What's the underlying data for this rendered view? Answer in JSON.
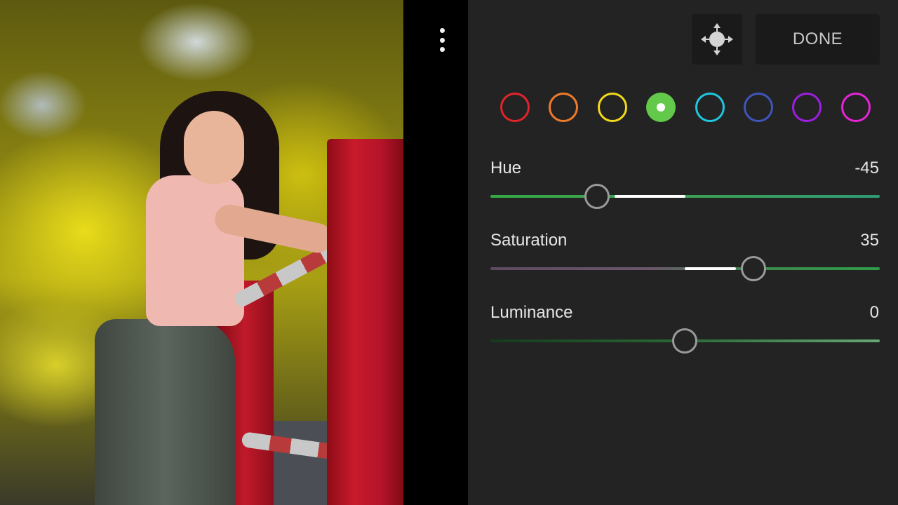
{
  "preview": {
    "description_alt": ""
  },
  "toolbar": {
    "more_icon": "more-vertical-icon",
    "target_icon": "target-adjustment-icon",
    "done_label": "DONE"
  },
  "colors": {
    "swatches": [
      {
        "name": "red",
        "hex": "#e0242b"
      },
      {
        "name": "orange",
        "hex": "#ef7b2a"
      },
      {
        "name": "yellow",
        "hex": "#f2d91c"
      },
      {
        "name": "green",
        "hex": "#63c94a",
        "selected": true
      },
      {
        "name": "aqua",
        "hex": "#1fc6de"
      },
      {
        "name": "blue",
        "hex": "#3f55b9"
      },
      {
        "name": "purple",
        "hex": "#9c1fe0"
      },
      {
        "name": "magenta",
        "hex": "#e624d6"
      }
    ]
  },
  "sliders": {
    "hue": {
      "label": "Hue",
      "value": "-45",
      "min": -100,
      "max": 100
    },
    "saturation": {
      "label": "Saturation",
      "value": "35",
      "min": -100,
      "max": 100
    },
    "luminance": {
      "label": "Luminance",
      "value": "0",
      "min": -100,
      "max": 100
    }
  }
}
